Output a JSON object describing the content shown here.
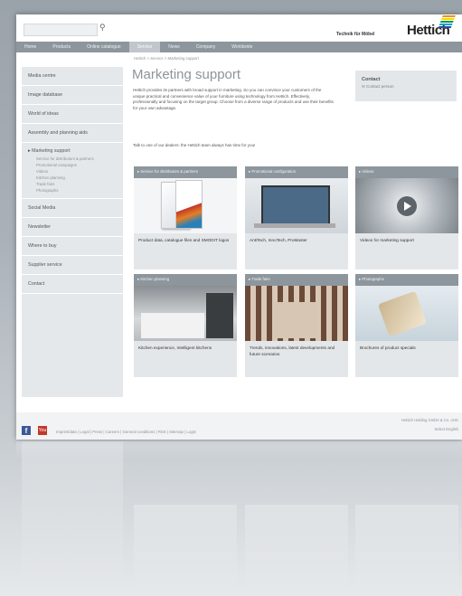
{
  "header": {
    "tagline": "Technik für Möbel",
    "logo": "Hettich",
    "logo_colors": [
      "#e30613",
      "#f39200",
      "#ffd500",
      "#009640",
      "#00a0e3",
      "#2a4b9b"
    ],
    "search_icon": "search-icon"
  },
  "nav": [
    "Home",
    "Products",
    "Online catalogue",
    "Service",
    "News",
    "Company",
    "Worldwide"
  ],
  "breadcrumb": "Hettich  >  Service  >  Marketing support",
  "page_title": "Marketing support",
  "intro": "Hettich provides its partners with broad support in marketing. So you can convince your customers of the unique practical and convenience value of your furniture using technology from Hettich. Effectively, professionally and focusing on the target group. Choose from a diverse range of products and use their benefits for your own advantage.",
  "talk": "Talk to one of our dealers: the Hettich team always has time for you!",
  "contact": {
    "title": "Contact",
    "link": "Contact person"
  },
  "sidebar": {
    "items_top": [
      "Media centre",
      "Image database",
      "World of ideas",
      "Assembly and planning aids"
    ],
    "active": "Marketing support",
    "subitems": [
      "Service for distributors & partners",
      "Promotional campaigns",
      "Videos",
      "Kitchen planning",
      "Trade fairs",
      "Photographs"
    ],
    "items_bottom": [
      "Social Media",
      "Newsletter",
      "Where to buy",
      "Supplier service",
      "Contact"
    ]
  },
  "tiles": [
    {
      "header": "Service for distributors & partners",
      "caption": "Product data, catalogue files and SMODIT logos"
    },
    {
      "header": "Promotional configuration",
      "caption": "AntiTech, InnoTech, ProMaster"
    },
    {
      "header": "Videos",
      "caption": "Videos for marketing support"
    },
    {
      "header": "Kitchen planning",
      "caption": "Kitchen experience, Intelligent kitchens"
    },
    {
      "header": "Trade fairs",
      "caption": "Trends, innovations, latest developments and future scenarios"
    },
    {
      "header": "Photographs",
      "caption": "Brochures of product specials"
    }
  ],
  "footer": {
    "links": "Imprint/data  |  Legal  |  Press  |  Careers  |  General conditions  |  RSS  |  Sitemap  |  Login",
    "right1": "Hettich Holding GmbH & Co. oHG",
    "right2": "Select English",
    "fb": "f",
    "yt": "You"
  }
}
